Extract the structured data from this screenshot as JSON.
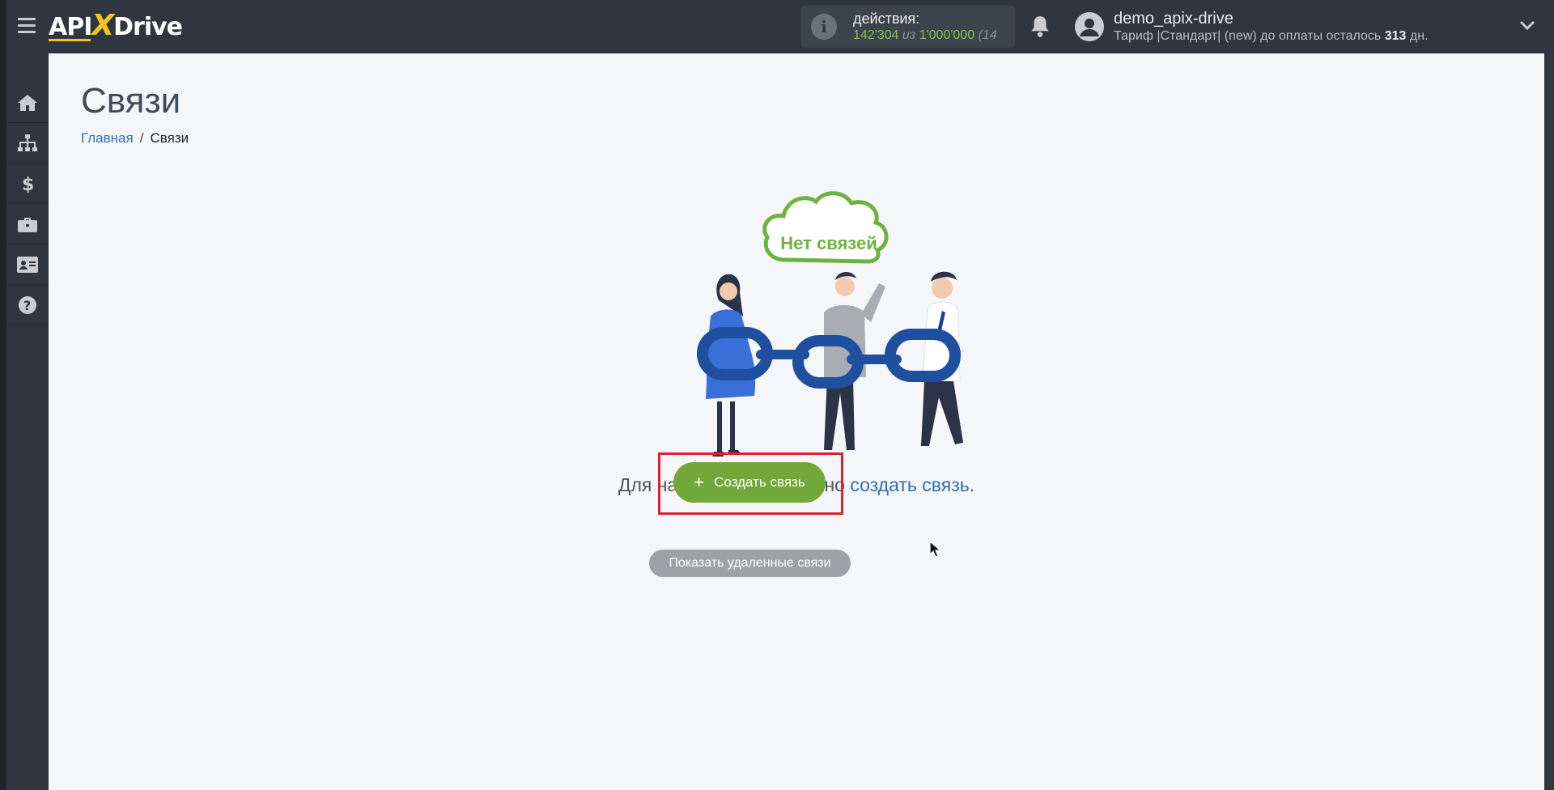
{
  "header": {
    "logo_api": "API",
    "logo_x": "X",
    "logo_drive": "Drive",
    "actions_label": "действия:",
    "actions_used": "142'304",
    "actions_of": "из",
    "actions_total": "1'000'000",
    "actions_extra": "(14",
    "user_name": "demo_apix-drive",
    "plan_text": "Тариф |Стандарт| (new) до оплаты осталось",
    "plan_days": "313",
    "plan_days_unit": "дн."
  },
  "sidebar": {
    "items": [
      {
        "name": "home-icon"
      },
      {
        "name": "sitemap-icon"
      },
      {
        "name": "dollar-icon"
      },
      {
        "name": "briefcase-icon"
      },
      {
        "name": "id-card-icon"
      },
      {
        "name": "question-icon"
      }
    ]
  },
  "page": {
    "title": "Связи",
    "breadcrumb_home": "Главная",
    "breadcrumb_separator": "/",
    "breadcrumb_current": "Связи"
  },
  "empty_state": {
    "cloud_text": "Нет связей",
    "hint_prefix": "Для начала работы нужно",
    "hint_link": "создать связь",
    "hint_suffix": ".",
    "create_button_icon": "+",
    "create_button_label": "Создать связь",
    "show_deleted_label": "Показать удаленные связи"
  },
  "colors": {
    "header_bg": "#2f3640",
    "main_bg": "#f5f6fa",
    "accent_green": "#72a83a",
    "link_blue": "#2f6fb0",
    "highlight_red": "#e01f2e",
    "logo_yellow": "#f5c518"
  }
}
